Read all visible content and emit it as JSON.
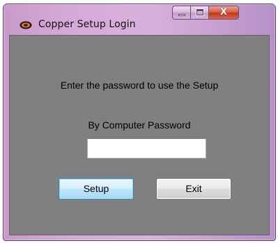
{
  "window": {
    "title": "Copper Setup Login",
    "close_glyph": "X",
    "icon": "copper-app-icon"
  },
  "form": {
    "prompt": "Enter the password to use the Setup",
    "password_label": "By Computer Password",
    "password_value": "",
    "setup_label": "Setup",
    "exit_label": "Exit"
  },
  "colors": {
    "client_background": "#808080",
    "frame_accent": "#d9b0dc",
    "close_button": "#c0371f",
    "default_button_border": "#3c7fb1"
  }
}
